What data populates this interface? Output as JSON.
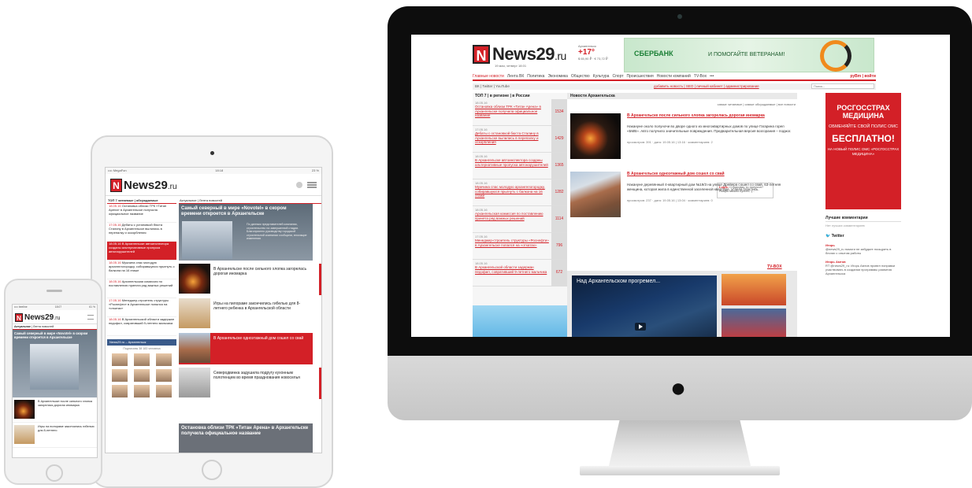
{
  "site": {
    "name": "News29",
    "tld": ".ru",
    "logo_letter": "N",
    "accent": "#d32027"
  },
  "desktop": {
    "date": "19 мая, четверг 18:01",
    "weather_city": "Архангельск",
    "weather_temp": "+17°",
    "weather_rates": "$ 65,90 ₽ · € 73,72 ₽",
    "banner_brand": "СБЕРБАНК",
    "banner_text": "И ПОМОГАЙТЕ ВЕТЕРАНАМ!",
    "nav": [
      "Главные новости",
      "Лента ВК",
      "Политика",
      "Экономика",
      "Общество",
      "Культура",
      "Спорт",
      "Происшествия",
      "Новости компаний",
      "TV-Box",
      "•••"
    ],
    "nav_right": "руВm | войти",
    "social": "ВК | Twitter | YouTube",
    "user_links": "добавить новость | SEO | личный кабинет | администрирование",
    "search_placeholder": "Поиск...",
    "top7_heading": "ТОП 7 | в регионе | в России",
    "top7": [
      {
        "date": "18.05.16",
        "title": "Остановка облизи ТРК «Титан Арена» в Архангельске получила официальное название",
        "count": "1534"
      },
      {
        "date": "17.05.16",
        "title": "Дебаты с остановкой бюста Сталину в Архангельске вылились в перепалку и оскорбления",
        "count": "1429"
      },
      {
        "date": "18.05.16",
        "title": "В Архангельске автоинспектора созданы альтернативные пропуска автонарушителей",
        "count": "1365"
      },
      {
        "date": "18.05.16",
        "title": "Мужчина спас молодую архангелогородку, собиравшуюся прыгнуть с балкона на 16 этаже",
        "count": "1282"
      },
      {
        "date": "18.05.16",
        "title": "Архангельская комиссия по поставлению принята ряд важных решений",
        "count": "1114"
      },
      {
        "date": "17.05.16",
        "title": "Менеджер-строитель структуры «Роснефти» в Архангельске попался на «откатах»",
        "count": "796"
      },
      {
        "date": "18.05.16",
        "title": "В Архангельской области задержан педофил, совративший 9-летнего мальчика",
        "count": "672"
      }
    ],
    "news_heading": "Новости Архангельска",
    "news_filter": "самые читаемые | самые обсуждаемые | все новости",
    "news": [
      {
        "title": "В Архангельске после сильного хлопка загорелась дорогая иномарка",
        "text": "Накануне около полуночи во дворе одного из многоквартирных домов по улице Гагарина горел «БМВ». Авто получило значительные повреждения. Предварительная версия возгорания – поджог.",
        "meta": "просмотров: 391 · дата: 19.05.16 | 13:16 · комментариев: 2"
      },
      {
        "title": "В Архангельске одноэтажный дом сошел со свай",
        "text": "Накануне деревянный 4-квартирный дом №19/3 на улице Дрейера сошел со свай. 63-летняя женщина, которая жила в единственной заселенной квартире, успела спастись.",
        "meta": "просмотров: 237 · дата: 19.05.16 | 13:04 · комментариев: 0"
      }
    ],
    "comment_user": "Logik:",
    "comment_text": "Страховку то получил? Новую можно купить :)...",
    "tvbox_label": "TV-BOX",
    "video_title": "Над Архангельском прогремел...",
    "ad_lines": [
      "РОСГОССТРАХ",
      "МЕДИЦИНА",
      "ОБМЕНЯЙТЕ СВОЙ ПОЛИС ОМС",
      "БЕСПЛАТНО!",
      "НА НОВЫЙ ПОЛИС ОМС «РОСГОССТРАХ МЕДИЦИНА»"
    ],
    "best_comments": "Лучшие комментарии",
    "no_comments": "Нет лучших комментариев",
    "twitter_label": "Twitter",
    "tweets": [
      {
        "user": "Игорь",
        "text": "@news29_ru помоги не забудьте поощрить в блогах с опытом работы"
      },
      {
        "user": "Игорь Амтов",
        "text": "RT @news29_ru: Игорь Амтов провел поправки участвовать в создании программы развития Архангельска"
      }
    ]
  },
  "tablet": {
    "carrier": "•••• MegaFon",
    "time": "18:18",
    "battery": "23 %",
    "left_tabs": "ТОП 7 читаемые | обсуждаемые",
    "list": [
      {
        "date": "18.05.16",
        "title": "Остановка облизи ТРК «Титан Арена» в Архангельске получила официальное название"
      },
      {
        "date": "17.05.16",
        "title": "Дебаты с установкой бюста Сталину в Архангельске вылились в перепалку и оскорбления"
      },
      {
        "date": "18.05.16",
        "title": "В Архангельске автоинспектора созданы альтернативные пропуска автонарушителей"
      },
      {
        "date": "18.05.16",
        "title": "Мужчина спас молодую архангелогородку, собиравшуюся прыгнуть с балкона на 16 этаже"
      },
      {
        "date": "18.05.16",
        "title": "Архангельская комиссия по поставлению принята ряд важных решений"
      },
      {
        "date": "17.05.16",
        "title": "Менеджер-строитель структуры «Роснефти» в Архангельске попался на «откатах»"
      },
      {
        "date": "18.05.16",
        "title": "В Архангельской области задержан педофил, совративший 9-летнего мальчика"
      }
    ],
    "vk_label": "News29.ru – Архангельск",
    "subscribers": "Подписаны 38 183 человека",
    "main_tabs": "Актуальное | Лента новостей",
    "hero_title": "Самый северный в мире «Novotel» в скором времени откроется в Архангельске",
    "hero_desc": "По данным представителей компании, строительство на завершенной стадии. Благоприятно руководству городской строительной компании сообщили, вносящие изменения",
    "stories": [
      "В Архангельске после сильного хлопка загорелась дорогая иномарка",
      "Игры на пилораме закончились гибелью для 8-летнего ребенка в Архангельской области",
      "В Архангельске одноэтажный дом сошел со свай",
      "Северодвинка задушила подругу кухонным полотенцем во время празднования новоселья"
    ],
    "bottom_title": "Остановка облизи ТРК «Титан Арена» в Архангельске получила официальное название"
  },
  "phone": {
    "carrier": "•••• beeline",
    "time": "18:07",
    "battery": "61 %",
    "tabs_active": "Актуальное",
    "tabs_other": "Лента новостей",
    "hero_title": "Самый северный в мире «Novotel» в скором времени откроется в Архангельске",
    "stories": [
      "В Архангельске после сильного хлопка загорелась дорогая иномарка",
      "Игры на пилораме закончились гибелью для 8-летнего"
    ]
  }
}
